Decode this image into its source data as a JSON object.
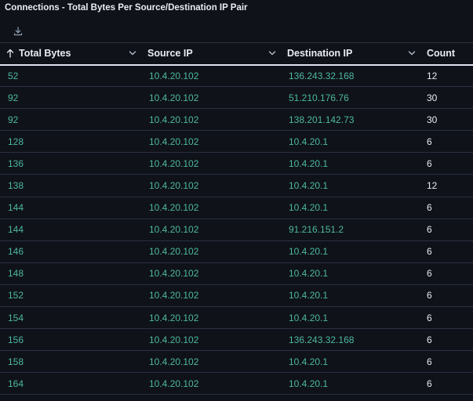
{
  "panel": {
    "title": "Connections - Total Bytes Per Source/Destination IP Pair"
  },
  "icons": {
    "download": "download-icon",
    "sort": "arrow-up-icon",
    "chevron": "chevron-down-icon"
  },
  "colors": {
    "background": "#0f1219",
    "accent": "#4db8a0",
    "text": "#e8ecf3"
  },
  "table": {
    "columns": [
      "Total Bytes",
      "Source IP",
      "Destination IP",
      "Count"
    ],
    "sorted_column": "Total Bytes",
    "sort_direction": "ascending",
    "rows": [
      [
        "52",
        "10.4.20.102",
        "136.243.32.168",
        "12"
      ],
      [
        "92",
        "10.4.20.102",
        "51.210.176.76",
        "30"
      ],
      [
        "92",
        "10.4.20.102",
        "138.201.142.73",
        "30"
      ],
      [
        "128",
        "10.4.20.102",
        "10.4.20.1",
        "6"
      ],
      [
        "136",
        "10.4.20.102",
        "10.4.20.1",
        "6"
      ],
      [
        "138",
        "10.4.20.102",
        "10.4.20.1",
        "12"
      ],
      [
        "144",
        "10.4.20.102",
        "10.4.20.1",
        "6"
      ],
      [
        "144",
        "10.4.20.102",
        "91.216.151.2",
        "6"
      ],
      [
        "146",
        "10.4.20.102",
        "10.4.20.1",
        "6"
      ],
      [
        "148",
        "10.4.20.102",
        "10.4.20.1",
        "6"
      ],
      [
        "152",
        "10.4.20.102",
        "10.4.20.1",
        "6"
      ],
      [
        "154",
        "10.4.20.102",
        "10.4.20.1",
        "6"
      ],
      [
        "156",
        "10.4.20.102",
        "136.243.32.168",
        "6"
      ],
      [
        "158",
        "10.4.20.102",
        "10.4.20.1",
        "6"
      ],
      [
        "164",
        "10.4.20.102",
        "10.4.20.1",
        "6"
      ]
    ]
  }
}
